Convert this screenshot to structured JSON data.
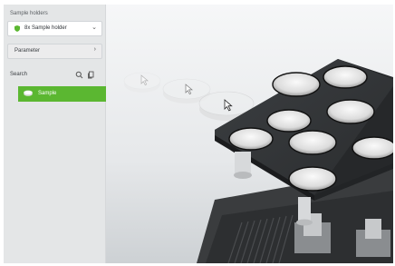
{
  "sidebar": {
    "sample_holders_title": "Sample holders",
    "holder_select": {
      "value": "8x Sample holder",
      "icon": "shield-icon"
    },
    "parameter_label": "Parameter",
    "search_label": "Search",
    "items": [
      {
        "label": "Sample",
        "icon": "sample-disk-icon",
        "selected": true
      }
    ]
  },
  "colors": {
    "accent": "#5bb731",
    "sidebar_bg": "#e4e6e7"
  }
}
